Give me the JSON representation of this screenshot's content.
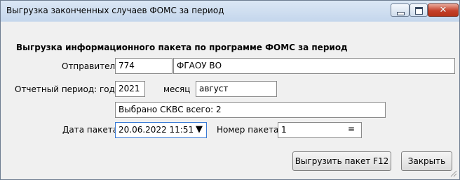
{
  "window": {
    "title": "Выгрузка законченных случаев ФОМС за период"
  },
  "form": {
    "heading": "Выгрузка информационного пакета по программе ФОМС за период",
    "sender": {
      "label": "Отправитель",
      "code": "774",
      "name": "ФГАОУ ВО"
    },
    "period": {
      "year_label": "Отчетный период: год",
      "year": "2021",
      "month_label": "месяц",
      "month": "август"
    },
    "summary": "Выбрано СКВС всего: 2",
    "package_date": {
      "label": "Дата пакета",
      "value": "20.06.2022 11:51",
      "dropdown_glyph": "▼"
    },
    "package_number": {
      "label": "Номер пакета",
      "value": "1",
      "button_glyph": "="
    }
  },
  "buttons": {
    "export": "Выгрузить пакет F12",
    "close": "Закрыть"
  },
  "icons": {
    "minimize": "minimize-icon",
    "maximize": "maximize-icon",
    "close": "close-icon"
  },
  "colors": {
    "titlebar": "#c4d6ec",
    "close_button": "#c5402a",
    "focus_border": "#3a7bd5"
  }
}
